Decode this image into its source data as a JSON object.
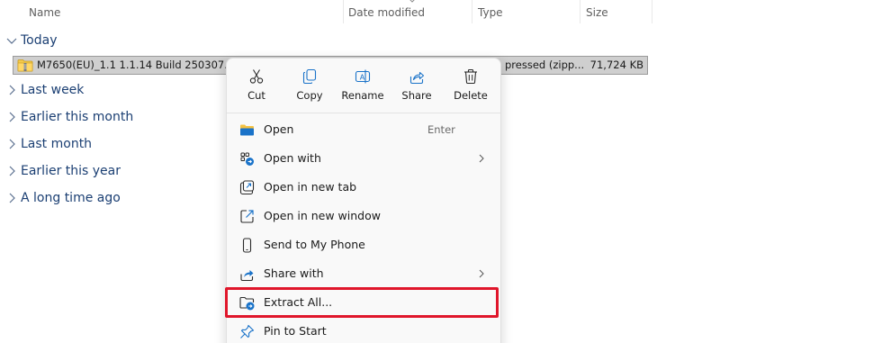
{
  "columns": {
    "name": "Name",
    "date_modified": "Date modified",
    "type": "Type",
    "size": "Size"
  },
  "groups": [
    {
      "label": "Today",
      "expanded": true
    },
    {
      "label": "Last week",
      "expanded": false
    },
    {
      "label": "Earlier this month",
      "expanded": false
    },
    {
      "label": "Last month",
      "expanded": false
    },
    {
      "label": "Earlier this year",
      "expanded": false
    },
    {
      "label": "A long time ago",
      "expanded": false
    }
  ],
  "file": {
    "name": "M7650(EU)_1.1 1.1.14 Build 250307.zip",
    "type_partial": "pressed (zipp...",
    "size": "71,724 KB",
    "icon": "zip-folder-icon"
  },
  "context_menu": {
    "quick_actions": [
      {
        "label": "Cut",
        "icon": "cut-icon"
      },
      {
        "label": "Copy",
        "icon": "copy-icon"
      },
      {
        "label": "Rename",
        "icon": "rename-icon"
      },
      {
        "label": "Share",
        "icon": "share-icon"
      },
      {
        "label": "Delete",
        "icon": "delete-icon"
      }
    ],
    "items": [
      {
        "label": "Open",
        "shortcut": "Enter",
        "icon": "folder-open-icon"
      },
      {
        "label": "Open with",
        "submenu": true,
        "icon": "open-with-icon"
      },
      {
        "label": "Open in new tab",
        "icon": "new-tab-icon"
      },
      {
        "label": "Open in new window",
        "icon": "new-window-icon"
      },
      {
        "label": "Send to My Phone",
        "icon": "phone-icon"
      },
      {
        "label": "Share with",
        "submenu": true,
        "icon": "share-with-icon"
      },
      {
        "label": "Extract All...",
        "icon": "extract-icon",
        "highlighted": true
      },
      {
        "label": "Pin to Start",
        "icon": "pin-icon"
      }
    ]
  },
  "colors": {
    "group_text": "#1b3f73",
    "selected_row": "#cfcfcf",
    "highlight": "#e0162b",
    "accent_blue": "#1a73c9"
  }
}
